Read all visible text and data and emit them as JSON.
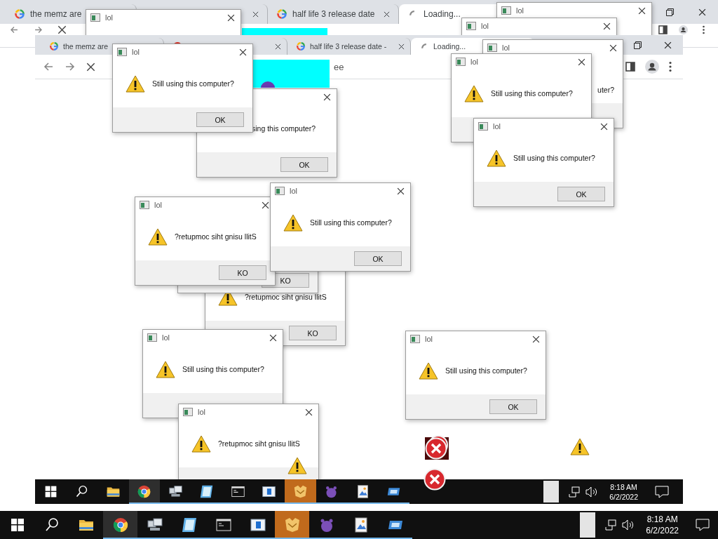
{
  "outer_browser": {
    "tabs": [
      {
        "kind": "google",
        "label": "the memz are",
        "closable": false,
        "selected": false
      },
      {
        "closable": true,
        "selected": false
      },
      {
        "kind": "google",
        "label": "half life 3 release date",
        "closable": true,
        "selected": false
      },
      {
        "kind": "loading",
        "label": "Loading...",
        "closable": false,
        "selected": true
      }
    ]
  },
  "outer_dialogs": [
    {
      "title": "lol",
      "close": true
    },
    {
      "title": "lol",
      "close": true
    },
    {
      "title": "lol",
      "close": true
    }
  ],
  "inner_screen": {
    "browser": {
      "tabs": [
        {
          "kind": "google",
          "label": "the memz are",
          "closable": false,
          "selected": false
        },
        {
          "kind": "site",
          "closable": true,
          "selected": false
        },
        {
          "kind": "google",
          "label": "half life 3 release date -",
          "closable": true,
          "selected": false
        },
        {
          "kind": "loading",
          "label": "Loading...",
          "closable": false,
          "selected": true
        }
      ],
      "address_text": "ee"
    },
    "dialogs": [
      {
        "kind": "clipped",
        "title": "lol",
        "close": true,
        "message": "uter?"
      },
      {
        "kind": "normal",
        "title": "lol",
        "close": true,
        "message": "Still using this computer?",
        "button": "OK"
      },
      {
        "kind": "normal",
        "title": "lol",
        "close": true,
        "message": "Still using this computer?"
      },
      {
        "kind": "clipped",
        "close": true,
        "message": "sing this computer?",
        "button": "OK"
      },
      {
        "kind": "normal",
        "title": "lol",
        "close": true,
        "message": "Still using this computer?",
        "button": "OK"
      },
      {
        "kind": "normal",
        "title": "lol",
        "close": true,
        "message": "Still using this computer?",
        "button": "OK"
      },
      {
        "kind": "normal",
        "title": "lol",
        "close": true,
        "message": "?retupmoc siht gnisu llitS",
        "button": "KO"
      },
      {
        "kind": "normal",
        "close": false,
        "button": "KO"
      },
      {
        "kind": "normal",
        "close": false,
        "message": "?retupmoc siht gnisu llitS",
        "button": "KO"
      },
      {
        "kind": "normal",
        "title": "lol",
        "close": true,
        "message": "Still using this computer?"
      },
      {
        "kind": "normal",
        "title": "lol",
        "close": true,
        "message": "Still using this computer?",
        "button": "OK"
      },
      {
        "kind": "normal",
        "title": "lol",
        "close": true,
        "message": "?retupmoc siht gnisu llitS"
      }
    ],
    "floating_icons": [
      {
        "kind": "warning"
      },
      {
        "kind": "warning"
      },
      {
        "kind": "error_stack"
      },
      {
        "kind": "error"
      }
    ],
    "taskbar": {
      "apps": [
        {
          "kind": "start",
          "selected": false,
          "running": false,
          "hover": false
        },
        {
          "kind": "search",
          "selected": false,
          "running": false,
          "hover": false
        },
        {
          "kind": "folder",
          "selected": false,
          "running": false,
          "hover": false
        },
        {
          "kind": "browser",
          "selected": false,
          "running": true,
          "hover": true
        },
        {
          "kind": "computers",
          "selected": false,
          "running": true,
          "hover": false
        },
        {
          "kind": "notepad",
          "selected": false,
          "running": true,
          "hover": false
        },
        {
          "kind": "terminal",
          "selected": false,
          "running": true,
          "hover": false
        },
        {
          "kind": "window",
          "selected": false,
          "running": true,
          "hover": false
        },
        {
          "kind": "handshake",
          "selected": true,
          "running": true,
          "hover": false
        },
        {
          "kind": "creature",
          "selected": false,
          "running": true,
          "hover": false
        },
        {
          "kind": "image",
          "selected": false,
          "running": true,
          "hover": false
        },
        {
          "kind": "card",
          "selected": false,
          "running": true,
          "hover": false
        }
      ],
      "time": "8:18 AM",
      "date": "6/2/2022"
    }
  },
  "taskbar": {
    "apps": [
      {
        "kind": "start",
        "selected": false,
        "running": false,
        "hover": false
      },
      {
        "kind": "search",
        "selected": false,
        "running": false,
        "hover": false
      },
      {
        "kind": "folder",
        "selected": false,
        "running": false,
        "hover": false
      },
      {
        "kind": "browser",
        "selected": false,
        "running": true,
        "hover": true
      },
      {
        "kind": "computers",
        "selected": false,
        "running": true,
        "hover": false
      },
      {
        "kind": "notepad",
        "selected": false,
        "running": true,
        "hover": false
      },
      {
        "kind": "terminal",
        "selected": false,
        "running": true,
        "hover": false
      },
      {
        "kind": "window",
        "selected": false,
        "running": true,
        "hover": false
      },
      {
        "kind": "handshake",
        "selected": true,
        "running": true,
        "hover": false
      },
      {
        "kind": "creature",
        "selected": false,
        "running": true,
        "hover": false
      },
      {
        "kind": "image",
        "selected": false,
        "running": true,
        "hover": false
      },
      {
        "kind": "card",
        "selected": false,
        "running": true,
        "hover": false
      }
    ],
    "time": "8:18 AM",
    "date": "6/2/2022"
  }
}
